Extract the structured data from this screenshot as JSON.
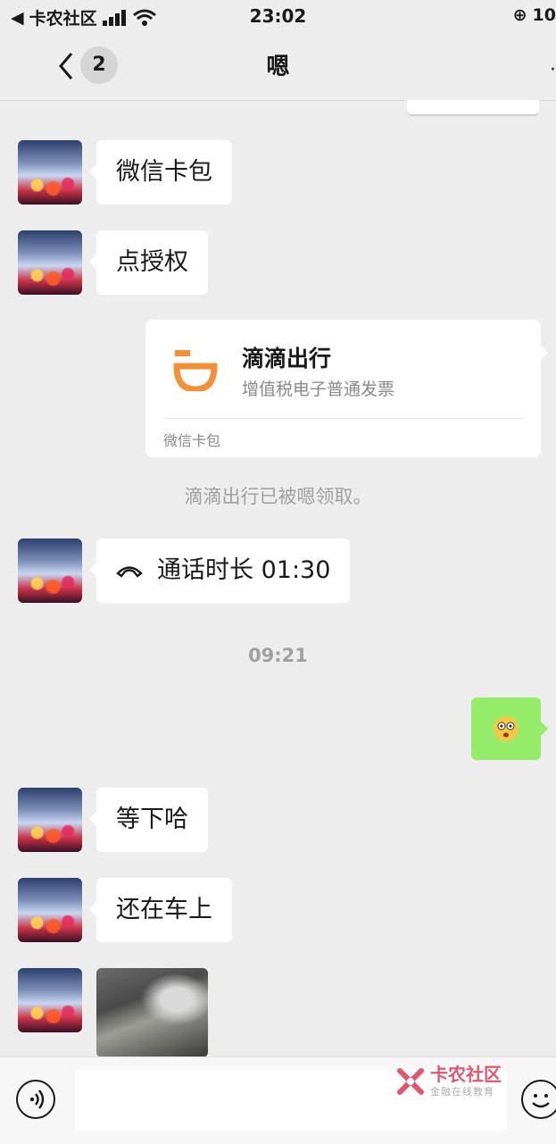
{
  "status_bar": {
    "carrier": "卡农社区",
    "time": "23:02",
    "battery_text": "10"
  },
  "nav": {
    "unread_count": "2",
    "title": "嗯"
  },
  "messages": {
    "m1": "微信卡包",
    "m2": "点授权",
    "card": {
      "title": "滴滴出行",
      "subtitle": "增值税电子普通发票",
      "footer": "微信卡包",
      "brand_color": "#f29138"
    },
    "system_note": "滴滴出行已被嗯领取。",
    "call": "通话时长 01:30",
    "timestamp": "09:21",
    "m3": "等下哈",
    "m4": "还在车上"
  },
  "watermark": {
    "title": "卡农社区",
    "subtitle": "金融在线教育"
  },
  "colors": {
    "bg": "#ededed",
    "bubble_self": "#95ec69",
    "bubble_other": "#ffffff"
  }
}
